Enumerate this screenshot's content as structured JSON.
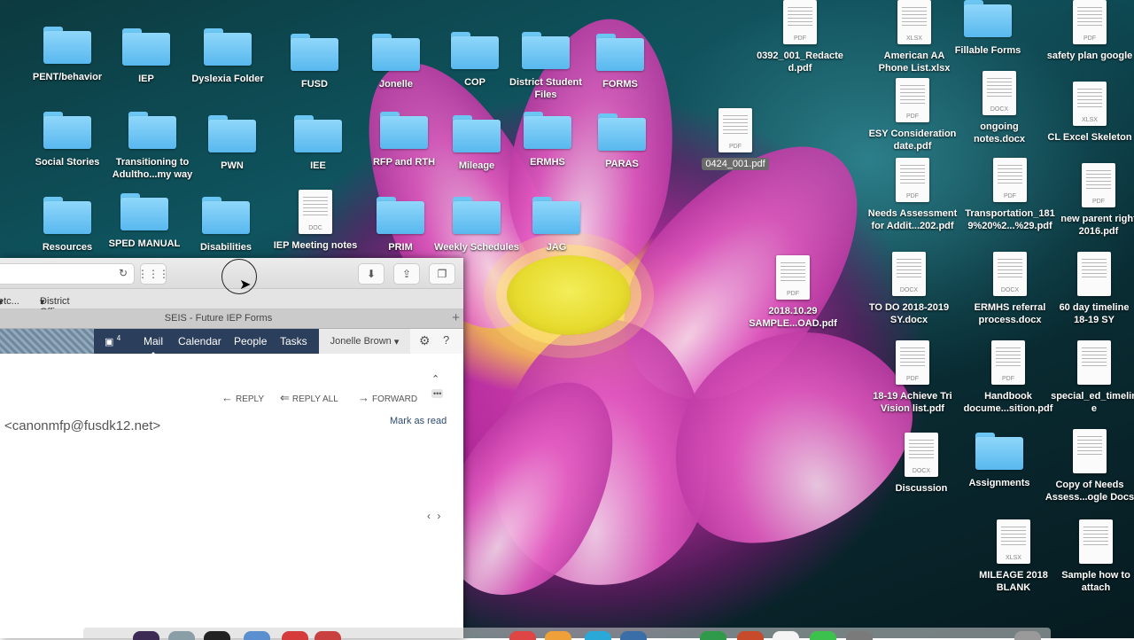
{
  "desktop": {
    "icons": [
      {
        "label": "PENT/behavior",
        "kind": "folder"
      },
      {
        "label": "IEP",
        "kind": "folder"
      },
      {
        "label": "Dyslexia Folder",
        "kind": "folder"
      },
      {
        "label": "FUSD",
        "kind": "folder"
      },
      {
        "label": "Jonelle",
        "kind": "folder"
      },
      {
        "label": "COP",
        "kind": "folder"
      },
      {
        "label": "District Student\nFiles",
        "kind": "folder"
      },
      {
        "label": "FORMS",
        "kind": "folder"
      },
      {
        "label": "Social Stories",
        "kind": "folder"
      },
      {
        "label": "Transitioning to\nAdultho...my way",
        "kind": "folder"
      },
      {
        "label": "PWN",
        "kind": "folder"
      },
      {
        "label": "IEE",
        "kind": "folder"
      },
      {
        "label": "RFP and RTH",
        "kind": "folder"
      },
      {
        "label": "Mileage",
        "kind": "folder"
      },
      {
        "label": "ERMHS",
        "kind": "folder"
      },
      {
        "label": "PARAS",
        "kind": "folder"
      },
      {
        "label": "Resources",
        "kind": "folder"
      },
      {
        "label": "SPED MANUAL",
        "kind": "folder"
      },
      {
        "label": "Disabilities",
        "kind": "folder"
      },
      {
        "label": "IEP Meeting notes",
        "kind": "doc",
        "type": "DOC"
      },
      {
        "label": "PRIM",
        "kind": "folder"
      },
      {
        "label": "Weekly Schedules",
        "kind": "folder"
      },
      {
        "label": "JAG",
        "kind": "folder"
      },
      {
        "label": "0424_001.pdf",
        "kind": "doc",
        "type": "PDF",
        "selected": true
      },
      {
        "label": "2018.10.29\nSAMPLE...OAD.pdf",
        "kind": "doc",
        "type": "PDF"
      },
      {
        "label": "0392_001_Redacte\nd.pdf",
        "kind": "doc",
        "type": "PDF"
      },
      {
        "label": "American AA\nPhone List.xlsx",
        "kind": "doc",
        "type": "XLSX"
      },
      {
        "label": "Fillable Forms",
        "kind": "folder"
      },
      {
        "label": "safety plan google",
        "kind": "doc",
        "type": "PDF"
      },
      {
        "label": "ESY Consideration\ndate.pdf",
        "kind": "doc",
        "type": "PDF"
      },
      {
        "label": "ongoing\nnotes.docx",
        "kind": "doc",
        "type": "DOCX"
      },
      {
        "label": "CL Excel Skeleton",
        "kind": "doc",
        "type": "XLSX"
      },
      {
        "label": "Needs Assessment\nfor Addit...202.pdf",
        "kind": "doc",
        "type": "PDF"
      },
      {
        "label": "Transportation_181\n9%20%2...%29.pdf",
        "kind": "doc",
        "type": "PDF"
      },
      {
        "label": "new parent right\n2016.pdf",
        "kind": "doc",
        "type": "PDF"
      },
      {
        "label": "TO DO 2018-2019\nSY.docx",
        "kind": "doc",
        "type": "DOCX"
      },
      {
        "label": "ERMHS referral\nprocess.docx",
        "kind": "doc",
        "type": "DOCX"
      },
      {
        "label": "60 day timeline\n18-19 SY",
        "kind": "doc",
        "type": ""
      },
      {
        "label": "18-19 Achieve Tri\nVision list.pdf",
        "kind": "doc",
        "type": "PDF"
      },
      {
        "label": "Handbook\ndocume...sition.pdf",
        "kind": "doc",
        "type": "PDF"
      },
      {
        "label": "special_ed_timelin\ne",
        "kind": "doc",
        "type": ""
      },
      {
        "label": "Discussion",
        "kind": "doc",
        "type": "DOCX"
      },
      {
        "label": "Assignments",
        "kind": "folder"
      },
      {
        "label": "Copy of Needs\nAssess...ogle Docs",
        "kind": "doc",
        "type": ""
      },
      {
        "label": "MILEAGE 2018\nBLANK",
        "kind": "doc",
        "type": "XLSX"
      },
      {
        "label": "Sample how to\nattach",
        "kind": "doc",
        "type": ""
      }
    ]
  },
  "browser": {
    "bookmarks": [
      "etc...",
      "District Office"
    ],
    "tab_title": "SEIS - Future IEP Forms",
    "tab_plus": "+",
    "calendar_badge": "4",
    "nav": [
      "Mail",
      "Calendar",
      "People",
      "Tasks"
    ],
    "user_name": "Jonelle Brown",
    "actions": {
      "reply": "REPLY",
      "reply_all": "REPLY ALL",
      "forward": "FORWARD",
      "more": "•••"
    },
    "sender_email": "<canonmfp@fusdk12.net>",
    "mark_as_read": "Mark as read",
    "collapse_glyph": "⌃",
    "pager": "‹ ›"
  },
  "icons": {
    "reload": "↻",
    "grid": "⋮⋮⋮",
    "download": "⬇",
    "share": "⇪",
    "tabs": "❐",
    "gear": "⚙",
    "help": "?",
    "calendar": "▣",
    "caret": "▾",
    "back_arrow": "←",
    "double_back": "⇐",
    "forward_arrow": "→"
  }
}
